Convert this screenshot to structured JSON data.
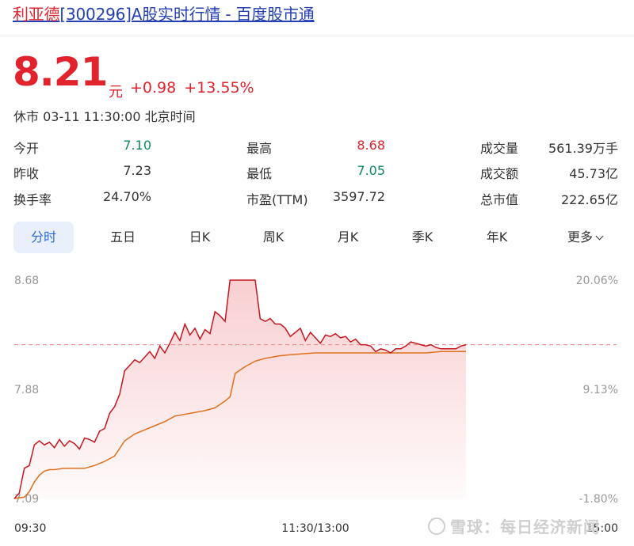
{
  "header": {
    "title_highlight": "利亚德",
    "title_rest": "[300296]A股实时行情 - 百度股市通"
  },
  "quote": {
    "price": "8.21",
    "unit": "元",
    "change": "+0.98",
    "change_pct": "+13.55%",
    "status": "休市 03-11 11:30:00 北京时间"
  },
  "stats": {
    "open_label": "今开",
    "open": "7.10",
    "prev_close_label": "昨收",
    "prev_close": "7.23",
    "turnover_label": "换手率",
    "turnover": "24.70%",
    "high_label": "最高",
    "high": "8.68",
    "low_label": "最低",
    "low": "7.05",
    "pe_label": "市盈(TTM)",
    "pe": "3597.72",
    "volume_label": "成交量",
    "volume": "561.39万手",
    "amount_label": "成交额",
    "amount": "45.73亿",
    "mcap_label": "总市值",
    "mcap": "222.65亿"
  },
  "tabs": [
    {
      "label": "分时",
      "active": true
    },
    {
      "label": "五日"
    },
    {
      "label": "日K"
    },
    {
      "label": "周K"
    },
    {
      "label": "月K"
    },
    {
      "label": "季K"
    },
    {
      "label": "年K"
    },
    {
      "label": "更多"
    }
  ],
  "colors": {
    "up": "#e1232d",
    "down": "#0f8a5f",
    "avg_line": "#e0701c",
    "link": "#2440b3",
    "tab_active": "#2f6ae0"
  },
  "chart_data": {
    "type": "line",
    "y_left_ticks": [
      "8.68",
      "7.88",
      "7.09"
    ],
    "y_right_ticks": [
      "20.06%",
      "9.13%",
      "-1.80%"
    ],
    "x_ticks": [
      "09:30",
      "11:30/13:00",
      "15:00"
    ],
    "ylim": [
      7.09,
      8.68
    ],
    "prev_close": 8.21,
    "session_minutes": 240,
    "series": [
      {
        "points": [
          [
            0,
            7.09
          ],
          [
            2,
            7.13
          ],
          [
            4,
            7.31
          ],
          [
            6,
            7.33
          ],
          [
            8,
            7.48
          ],
          [
            10,
            7.51
          ],
          [
            12,
            7.48
          ],
          [
            14,
            7.5
          ],
          [
            16,
            7.46
          ],
          [
            18,
            7.52
          ],
          [
            20,
            7.47
          ],
          [
            22,
            7.51
          ],
          [
            24,
            7.49
          ],
          [
            26,
            7.45
          ],
          [
            28,
            7.53
          ],
          [
            30,
            7.52
          ],
          [
            32,
            7.5
          ],
          [
            34,
            7.58
          ],
          [
            36,
            7.6
          ],
          [
            38,
            7.71
          ],
          [
            40,
            7.76
          ],
          [
            42,
            7.85
          ],
          [
            44,
            8.02
          ],
          [
            46,
            8.06
          ],
          [
            48,
            8.1
          ],
          [
            50,
            8.08
          ],
          [
            52,
            8.12
          ],
          [
            54,
            8.16
          ],
          [
            56,
            8.11
          ],
          [
            58,
            8.2
          ],
          [
            60,
            8.15
          ],
          [
            62,
            8.22
          ],
          [
            64,
            8.3
          ],
          [
            66,
            8.24
          ],
          [
            68,
            8.36
          ],
          [
            70,
            8.28
          ],
          [
            72,
            8.33
          ],
          [
            74,
            8.25
          ],
          [
            76,
            8.32
          ],
          [
            78,
            8.29
          ],
          [
            80,
            8.45
          ],
          [
            82,
            8.42
          ],
          [
            84,
            8.38
          ],
          [
            86,
            8.68
          ],
          [
            88,
            8.68
          ],
          [
            90,
            8.68
          ],
          [
            92,
            8.68
          ],
          [
            94,
            8.68
          ],
          [
            96,
            8.68
          ],
          [
            98,
            8.4
          ],
          [
            100,
            8.38
          ],
          [
            102,
            8.4
          ],
          [
            104,
            8.36
          ],
          [
            106,
            8.36
          ],
          [
            108,
            8.33
          ],
          [
            110,
            8.27
          ],
          [
            112,
            8.3
          ],
          [
            114,
            8.33
          ],
          [
            116,
            8.24
          ],
          [
            118,
            8.3
          ],
          [
            120,
            8.26
          ],
          [
            122,
            8.22
          ],
          [
            124,
            8.28
          ],
          [
            126,
            8.27
          ],
          [
            128,
            8.29
          ],
          [
            130,
            8.26
          ],
          [
            132,
            8.27
          ],
          [
            134,
            8.23
          ],
          [
            136,
            8.25
          ],
          [
            138,
            8.21
          ],
          [
            140,
            8.21
          ],
          [
            142,
            8.2
          ],
          [
            144,
            8.16
          ],
          [
            146,
            8.18
          ],
          [
            148,
            8.17
          ],
          [
            150,
            8.15
          ],
          [
            152,
            8.18
          ],
          [
            154,
            8.18
          ],
          [
            156,
            8.2
          ],
          [
            158,
            8.23
          ],
          [
            160,
            8.22
          ],
          [
            162,
            8.21
          ],
          [
            164,
            8.2
          ],
          [
            166,
            8.21
          ],
          [
            168,
            8.19
          ],
          [
            170,
            8.18
          ],
          [
            172,
            8.18
          ],
          [
            174,
            8.18
          ],
          [
            176,
            8.18
          ],
          [
            178,
            8.2
          ],
          [
            180,
            8.21
          ]
        ]
      },
      {
        "points": [
          [
            0,
            7.09
          ],
          [
            4,
            7.1
          ],
          [
            6,
            7.14
          ],
          [
            8,
            7.21
          ],
          [
            10,
            7.26
          ],
          [
            12,
            7.29
          ],
          [
            14,
            7.3
          ],
          [
            16,
            7.3
          ],
          [
            20,
            7.31
          ],
          [
            28,
            7.31
          ],
          [
            32,
            7.33
          ],
          [
            36,
            7.36
          ],
          [
            40,
            7.4
          ],
          [
            44,
            7.51
          ],
          [
            48,
            7.56
          ],
          [
            52,
            7.59
          ],
          [
            56,
            7.62
          ],
          [
            60,
            7.65
          ],
          [
            64,
            7.69
          ],
          [
            70,
            7.71
          ],
          [
            76,
            7.73
          ],
          [
            80,
            7.75
          ],
          [
            84,
            7.8
          ],
          [
            86,
            7.83
          ],
          [
            88,
            8.0
          ],
          [
            92,
            8.05
          ],
          [
            96,
            8.09
          ],
          [
            100,
            8.11
          ],
          [
            106,
            8.13
          ],
          [
            112,
            8.14
          ],
          [
            120,
            8.15
          ],
          [
            130,
            8.15
          ],
          [
            150,
            8.15
          ],
          [
            164,
            8.15
          ],
          [
            170,
            8.16
          ],
          [
            180,
            8.16
          ]
        ]
      }
    ]
  },
  "watermark": "雪球：每日经济新闻"
}
